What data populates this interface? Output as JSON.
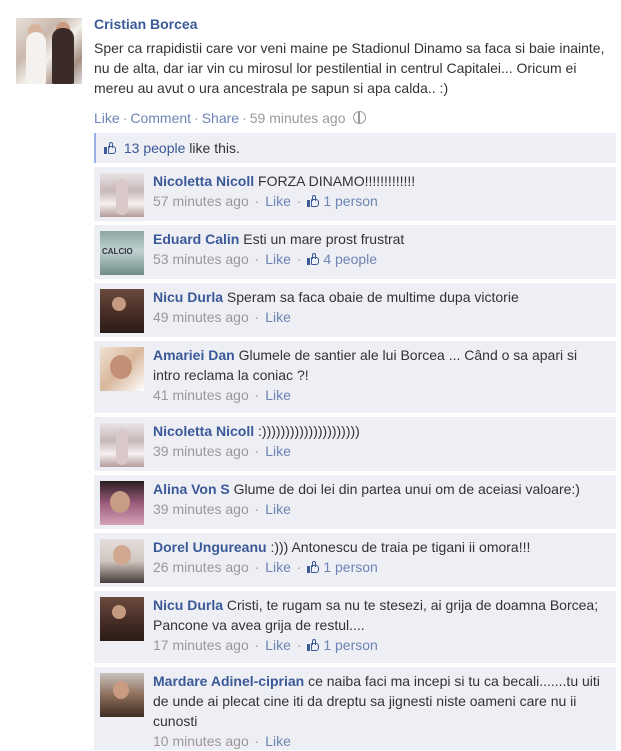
{
  "post": {
    "author": "Cristian Borcea",
    "text": "Sper ca rrapidistii care vor veni maine pe Stadionul Dinamo sa faca si baie inainte, nu de alta, dar iar vin cu mirosul lor pestilential in centrul Capitalei... Oricum ei mereu au avut o ura ancestrala pe sapun si apa calda.. :)",
    "actions": {
      "like": "Like",
      "comment": "Comment",
      "share": "Share",
      "time": "59 minutes ago"
    },
    "likes": {
      "people": "13 people",
      "suffix": "like this."
    }
  },
  "comments": [
    {
      "name": "Nicoletta Nicoll",
      "text": "FORZA DINAMO!!!!!!!!!!!!!",
      "time": "57 minutes ago",
      "like": "Like",
      "likes": "1 person"
    },
    {
      "name": "Eduard Calin",
      "text": "Esti un mare prost frustrat",
      "time": "53 minutes ago",
      "like": "Like",
      "likes": "4 people"
    },
    {
      "name": "Nicu Durla",
      "text": "Speram sa faca obaie de multime dupa victorie",
      "time": "49 minutes ago",
      "like": "Like"
    },
    {
      "name": "Amariei Dan",
      "text": "Glumele de santier ale lui Borcea ... Când o sa apari si intro reclama la coniac ?!",
      "time": "41 minutes ago",
      "like": "Like"
    },
    {
      "name": "Nicoletta Nicoll",
      "text": ":)))))))))))))))))))))",
      "time": "39 minutes ago",
      "like": "Like"
    },
    {
      "name": "Alina Von S",
      "text": "Glume de doi lei din partea unui om de aceiasi valoare:)",
      "time": "39 minutes ago",
      "like": "Like"
    },
    {
      "name": "Dorel Ungureanu",
      "text": ":))) Antonescu de traia pe tigani ii omora!!!",
      "time": "26 minutes ago",
      "like": "Like",
      "likes": "1 person"
    },
    {
      "name": "Nicu Durla",
      "text": "Cristi, te rugam sa nu te stesezi, ai grija de doamna Borcea; Pancone va avea grija de restul....",
      "time": "17 minutes ago",
      "like": "Like",
      "likes": "1 person"
    },
    {
      "name": "Mardare Adinel-ciprian",
      "text": "ce naiba faci ma incepi si tu ca becali.......tu uiti de unde ai plecat cine iti da dreptu sa jignesti niste oameni care nu ii cunosti",
      "time": "10 minutes ago",
      "like": "Like"
    }
  ],
  "colors": {
    "link": "#3b5998",
    "panel": "#edeff4",
    "muted": "#999999",
    "action": "#6d84b4"
  }
}
